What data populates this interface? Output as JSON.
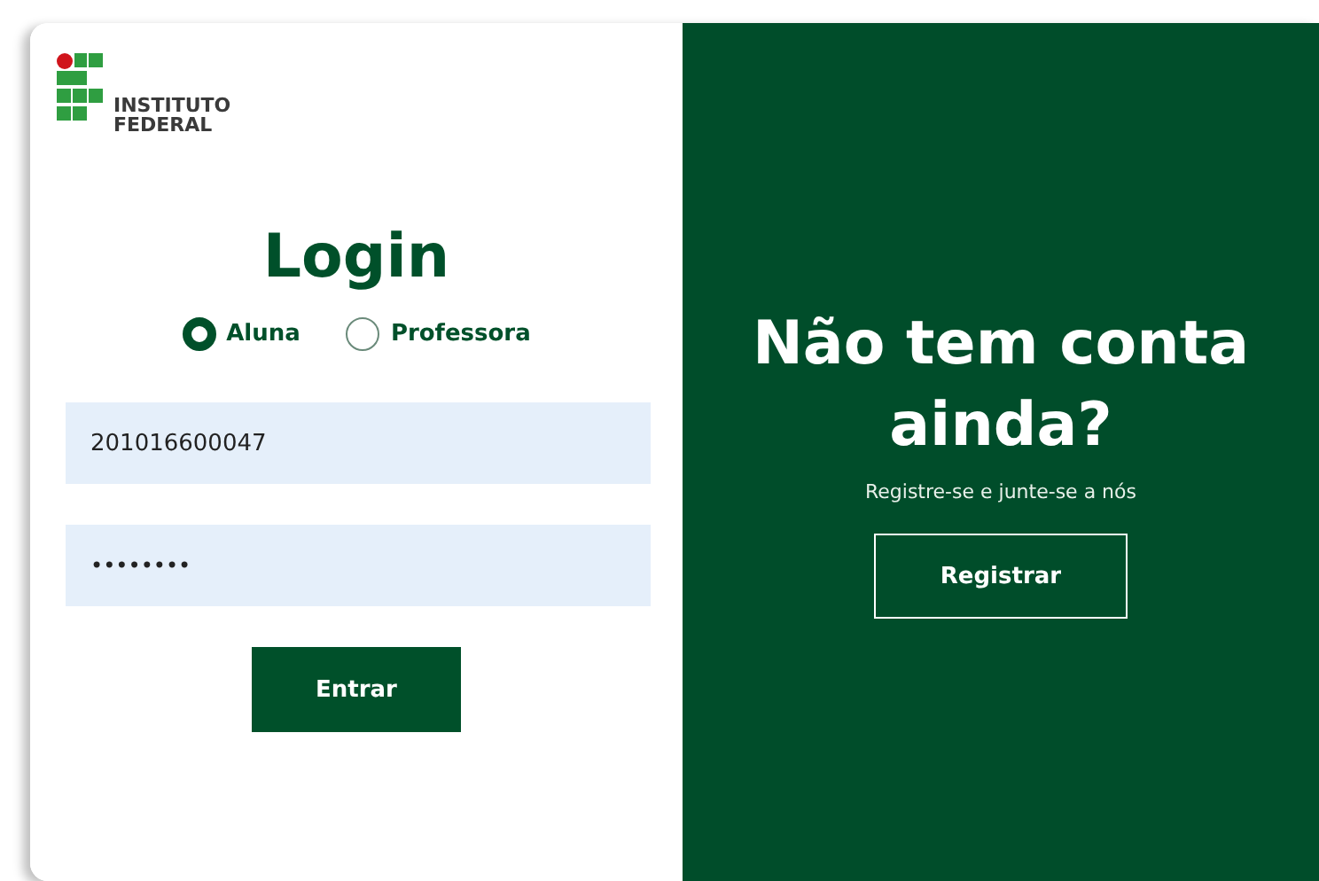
{
  "logo": {
    "line1": "INSTITUTO",
    "line2": "FEDERAL"
  },
  "login": {
    "title": "Login",
    "roles": [
      {
        "label": "Aluna",
        "selected": true
      },
      {
        "label": "Professora",
        "selected": false
      }
    ],
    "username": {
      "value": "201016600047"
    },
    "password": {
      "value": "••••••••"
    },
    "submit": "Entrar"
  },
  "signup": {
    "title": "Não tem conta ainda?",
    "subtitle": "Registre-se e junte-se a nós",
    "button": "Registrar"
  }
}
